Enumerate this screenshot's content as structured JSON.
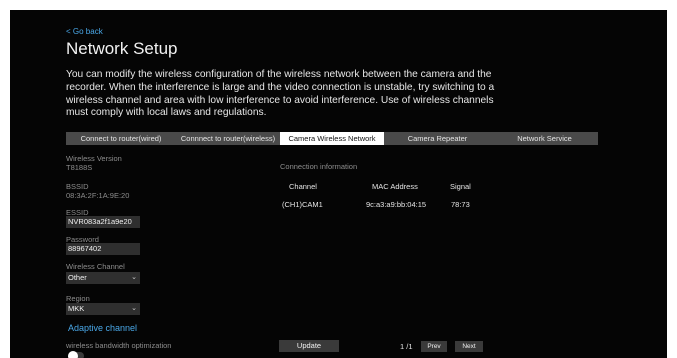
{
  "header": {
    "back_label": "< Go back",
    "title": "Network Setup",
    "description": "You can modify the wireless configuration of the wireless network between the camera and the recorder. When the interference is large and the video connection is unstable, try switching to a wireless channel and area with low interference to avoid interference. Use of wireless channels must comply with local laws and regulations."
  },
  "tabs": [
    {
      "label": "Connect to router(wired)"
    },
    {
      "label": "Connnect to router(wireless)"
    },
    {
      "label": "Camera Wireless Network"
    },
    {
      "label": "Camera Repeater"
    },
    {
      "label": "Network Service"
    }
  ],
  "fields": {
    "wireless_version": {
      "label": "Wireless Version",
      "value": "T8188S"
    },
    "bssid": {
      "label": "BSSID",
      "value": "08:3A:2F:1A:9E:20"
    },
    "essid": {
      "label": "ESSID",
      "value": "NVR083a2f1a9e20"
    },
    "password": {
      "label": "Password",
      "value": "88967402"
    },
    "wireless_channel": {
      "label": "Wireless Channel",
      "value": "Other"
    },
    "region": {
      "label": "Region",
      "value": "MKK"
    }
  },
  "adaptive_channel_label": "Adaptive channel",
  "bandwidth_label": "wireless bandwidth optimization",
  "connection": {
    "title": "Connection information",
    "columns": [
      "Channel",
      "MAC Address",
      "Signal"
    ],
    "rows": [
      [
        "(CH1)CAM1",
        "9c:a3:a9:bb:04:15",
        "78:73"
      ]
    ]
  },
  "footer": {
    "update_label": "Update",
    "page_indicator": "1 /1",
    "prev_label": "Prev",
    "next_label": "Next"
  },
  "colors": {
    "background": "#050505",
    "accent_link": "#4aa8e8",
    "tab_bar": "#4a4a4a",
    "active_tab": "#ffffff"
  }
}
